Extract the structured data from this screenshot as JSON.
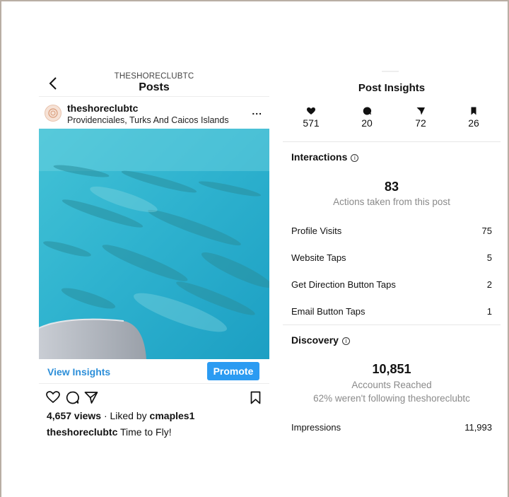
{
  "post_screen": {
    "brand": "THESHORECLUBTC",
    "title": "Posts",
    "username": "theshoreclubtc",
    "location": "Providenciales, Turks And Caicos Islands",
    "more_label": "...",
    "view_insights_label": "View Insights",
    "promote_label": "Promote",
    "views": "4,657 views",
    "liked_prefix": " · Liked by ",
    "liked_by": "cmaples1",
    "caption_user": "theshoreclubtc",
    "caption_text": " Time to Fly!",
    "accent_color": "#2b9bf2",
    "icons": [
      "back-icon",
      "avatar",
      "more-icon",
      "heart-icon",
      "comment-icon",
      "share-icon",
      "bookmark-icon"
    ]
  },
  "insights_screen": {
    "title": "Post Insights",
    "metrics": [
      {
        "icon": "heart-icon",
        "value": "571"
      },
      {
        "icon": "comment-icon",
        "value": "20"
      },
      {
        "icon": "share-icon",
        "value": "72"
      },
      {
        "icon": "bookmark-icon",
        "value": "26"
      }
    ],
    "interactions": {
      "title": "Interactions",
      "info": "i",
      "total": "83",
      "total_label": "Actions taken from this post",
      "rows": [
        {
          "label": "Profile Visits",
          "value": "75"
        },
        {
          "label": "Website Taps",
          "value": "5"
        },
        {
          "label": "Get Direction Button Taps",
          "value": "2"
        },
        {
          "label": "Email Button Taps",
          "value": "1"
        }
      ]
    },
    "discovery": {
      "title": "Discovery",
      "info": "i",
      "total": "10,851",
      "total_label": "Accounts Reached",
      "following_note": "62% weren't following theshoreclubtc",
      "rows": [
        {
          "label": "Impressions",
          "value": "11,993"
        }
      ]
    }
  }
}
